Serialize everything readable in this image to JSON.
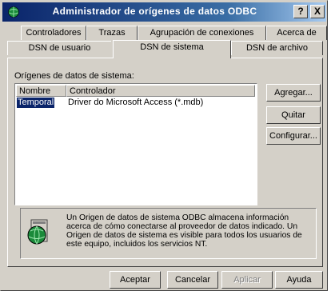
{
  "window": {
    "title": "Administrador de orígenes de datos ODBC"
  },
  "titlebar_buttons": {
    "help": "?",
    "close": "X"
  },
  "tabs": {
    "row1": [
      "Controladores",
      "Trazas",
      "Agrupación de conexiones",
      "Acerca de"
    ],
    "row2": [
      "DSN de usuario",
      "DSN de sistema",
      "DSN de archivo"
    ],
    "active": "DSN de sistema"
  },
  "panel": {
    "list_label": "Orígenes de datos de sistema:",
    "columns": [
      "Nombre",
      "Controlador"
    ],
    "rows": [
      {
        "name": "Temporal",
        "driver": "Driver do Microsoft Access (*.mdb)"
      }
    ]
  },
  "side_buttons": {
    "add": "Agregar...",
    "remove": "Quitar",
    "configure": "Configurar..."
  },
  "info": {
    "icon": "odbc-globe-icon",
    "text": "Un Origen de datos de sistema ODBC almacena información acerca de cómo conectarse al proveedor de datos indicado. Un Origen de datos de sistema es visible para todos los usuarios de este equipo, incluidos los servicios NT."
  },
  "bottom_buttons": {
    "ok": "Aceptar",
    "cancel": "Cancelar",
    "apply": "Aplicar",
    "help": "Ayuda"
  },
  "colors": {
    "title_start": "#0a246a",
    "title_end": "#a6caf0",
    "face": "#d4d0c8",
    "selection": "#0a246a"
  }
}
